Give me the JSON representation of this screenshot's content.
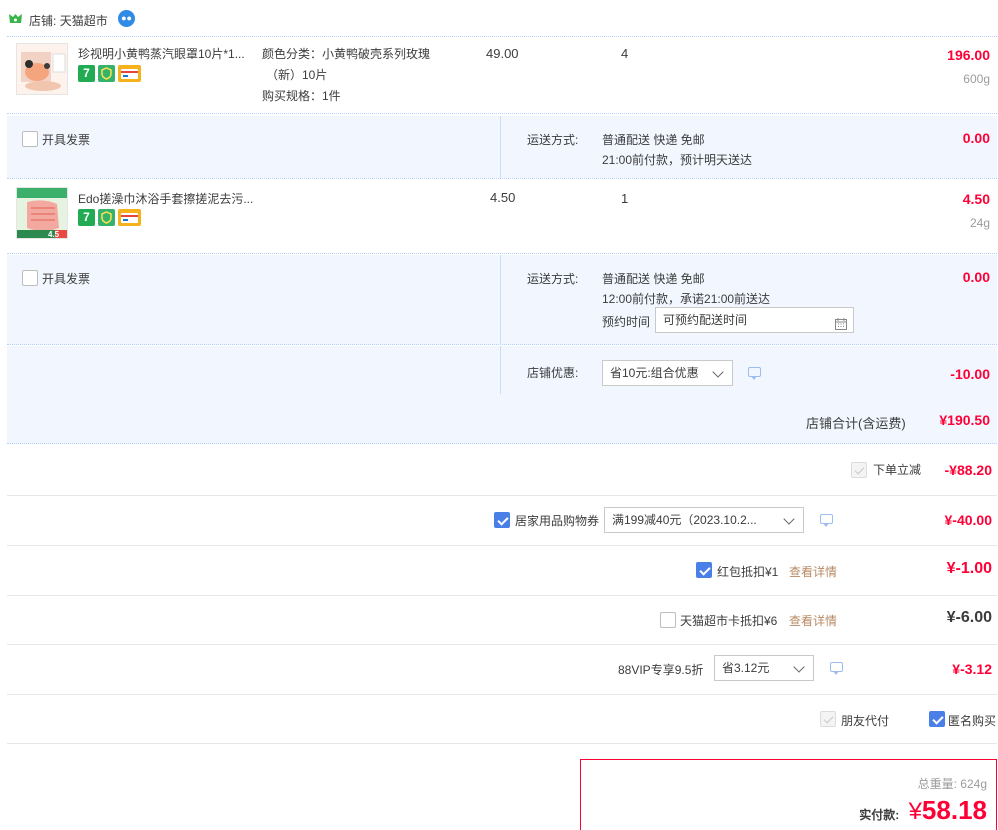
{
  "shop": {
    "label": "店铺:",
    "name": "天猫超市"
  },
  "items": [
    {
      "title": "珍视明小黄鸭蒸汽眼罩10片*1...",
      "sku_line1": "颜色分类：小黄鸭破壳系列玫瑰",
      "sku_line2": "（新）10片",
      "sku_line3": "购买规格：1件",
      "unit_price": "49.00",
      "qty": "4",
      "subtotal": "196.00",
      "weight": "600g",
      "thumb_price": ""
    },
    {
      "title": "Edo搓澡巾沐浴手套擦搓泥去污...",
      "sku_line1": "",
      "unit_price": "4.50",
      "qty": "1",
      "subtotal": "4.50",
      "weight": "24g",
      "thumb_price": "4.5"
    }
  ],
  "invoice_label": "开具发票",
  "delivery": [
    {
      "label": "运送方式:",
      "method": "普通配送 快递 免邮",
      "note": "21:00前付款，预计明天送达",
      "fee": "0.00"
    },
    {
      "label": "运送方式:",
      "method": "普通配送 快递 免邮",
      "note": "12:00前付款，承诺21:00前送达",
      "fee": "0.00",
      "appt_label": "预约时间",
      "appt_placeholder": "可预约配送时间"
    }
  ],
  "shop_discount": {
    "label": "店铺优惠:",
    "select": "省10元:组合优惠",
    "amount": "-10.00"
  },
  "shop_total": {
    "label": "店铺合计(含运费)",
    "amount": "¥190.50"
  },
  "order_discount": {
    "label": "下单立减",
    "amount": "-¥88.20"
  },
  "coupon": {
    "label": "居家用品购物券",
    "select": "满199减40元（2023.10.2...",
    "amount": "¥-40.00"
  },
  "redpacket": {
    "label": "红包抵扣¥1",
    "detail": "查看详情",
    "amount": "¥-1.00"
  },
  "tmallcard": {
    "label": "天猫超市卡抵扣¥6",
    "detail": "查看详情",
    "amount": "¥-6.00"
  },
  "vip": {
    "label": "88VIP专享9.5折",
    "select": "省3.12元",
    "amount": "¥-3.12"
  },
  "friend_pay": "朋友代付",
  "anonymous": "匿名购买",
  "summary": {
    "weight_label": "总重量:",
    "weight": "624g",
    "pay_label": "实付款:",
    "currency": "¥",
    "pay": "58.18"
  },
  "colors": {
    "price_red": "#ff0036",
    "row_blue": "#f2f7ff",
    "check_blue": "#4a7fe8",
    "link_brown": "#b88a64"
  }
}
